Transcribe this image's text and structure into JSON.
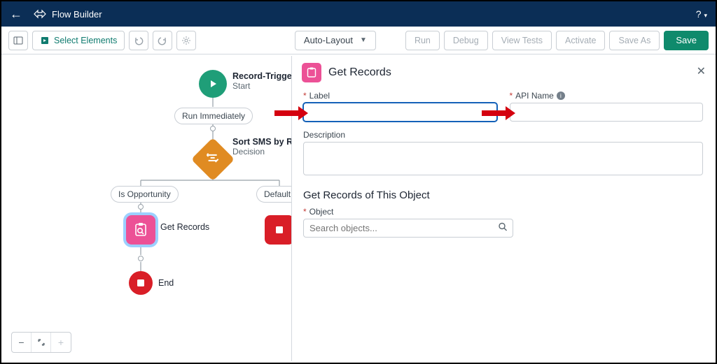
{
  "header": {
    "title": "Flow Builder",
    "help_label": "?"
  },
  "toolbar": {
    "select_elements": "Select Elements",
    "auto_layout": "Auto-Layout",
    "buttons": {
      "run": "Run",
      "debug": "Debug",
      "view_tests": "View Tests",
      "activate": "Activate",
      "save_as": "Save As",
      "save": "Save"
    }
  },
  "canvas": {
    "start": {
      "title": "Record-Triggere",
      "subtitle": "Start"
    },
    "run_immediately": "Run Immediately",
    "decision": {
      "title": "Sort SMS by Rec",
      "subtitle": "Decision"
    },
    "branch_left": "Is Opportunity",
    "branch_right": "Default O",
    "get_records": "Get Records",
    "end": "End"
  },
  "panel": {
    "title": "Get Records",
    "label_field": "Label",
    "api_name_field": "API Name",
    "description_field": "Description",
    "section_title": "Get Records of This Object",
    "object_field": "Object",
    "object_placeholder": "Search objects..."
  }
}
